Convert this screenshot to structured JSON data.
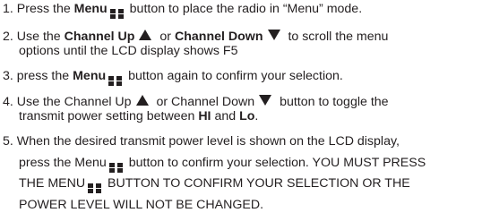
{
  "steps": [
    {
      "number": "1.",
      "lines": [
        {
          "a": "Press the ",
          "b": "Menu",
          "c": " button to place the radio in “Menu” mode."
        }
      ]
    },
    {
      "number": "2.",
      "lines": [
        {
          "a": "Use the ",
          "b": "Channel Up",
          "c": " or ",
          "d": "Channel Down",
          "e": " to scroll the menu"
        },
        {
          "a": "options until the LCD display shows F5"
        }
      ]
    },
    {
      "number": "3.",
      "lines": [
        {
          "a": "press the ",
          "b": "Menu",
          "c": " button again to confirm your selection."
        }
      ]
    },
    {
      "number": "4.",
      "lines": [
        {
          "a": "Use the Channel Up",
          "b": " or Channel Down",
          "c": " button to toggle the"
        },
        {
          "a": "transmit power setting between ",
          "b": "HI",
          "c": " and ",
          "d": "Lo",
          "e": "."
        }
      ]
    },
    {
      "number": "5.",
      "lines": [
        {
          "a": "When the desired transmit power level is shown on the LCD display,"
        },
        {
          "a": "press the Menu",
          "b": " button to confirm your selection. YOU MUST PRESS"
        },
        {
          "a": "THE MENU",
          "b": " BUTTON TO CONFIRM YOUR SELECTION OR THE"
        },
        {
          "a": "POWER LEVEL WILL NOT BE CHANGED."
        }
      ]
    }
  ],
  "icons": {
    "menu": "menu-button-icon",
    "up": "channel-up-triangle-icon",
    "down": "channel-down-triangle-icon"
  },
  "colors": {
    "text": "#231f20",
    "background": "#ffffff"
  }
}
